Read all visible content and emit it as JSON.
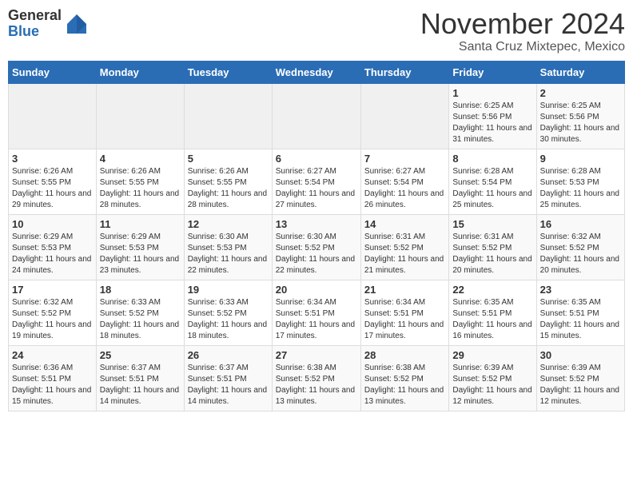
{
  "logo": {
    "general": "General",
    "blue": "Blue"
  },
  "header": {
    "month": "November 2024",
    "location": "Santa Cruz Mixtepec, Mexico"
  },
  "days_of_week": [
    "Sunday",
    "Monday",
    "Tuesday",
    "Wednesday",
    "Thursday",
    "Friday",
    "Saturday"
  ],
  "weeks": [
    [
      {
        "day": "",
        "info": ""
      },
      {
        "day": "",
        "info": ""
      },
      {
        "day": "",
        "info": ""
      },
      {
        "day": "",
        "info": ""
      },
      {
        "day": "",
        "info": ""
      },
      {
        "day": "1",
        "info": "Sunrise: 6:25 AM\nSunset: 5:56 PM\nDaylight: 11 hours and 31 minutes."
      },
      {
        "day": "2",
        "info": "Sunrise: 6:25 AM\nSunset: 5:56 PM\nDaylight: 11 hours and 30 minutes."
      }
    ],
    [
      {
        "day": "3",
        "info": "Sunrise: 6:26 AM\nSunset: 5:55 PM\nDaylight: 11 hours and 29 minutes."
      },
      {
        "day": "4",
        "info": "Sunrise: 6:26 AM\nSunset: 5:55 PM\nDaylight: 11 hours and 28 minutes."
      },
      {
        "day": "5",
        "info": "Sunrise: 6:26 AM\nSunset: 5:55 PM\nDaylight: 11 hours and 28 minutes."
      },
      {
        "day": "6",
        "info": "Sunrise: 6:27 AM\nSunset: 5:54 PM\nDaylight: 11 hours and 27 minutes."
      },
      {
        "day": "7",
        "info": "Sunrise: 6:27 AM\nSunset: 5:54 PM\nDaylight: 11 hours and 26 minutes."
      },
      {
        "day": "8",
        "info": "Sunrise: 6:28 AM\nSunset: 5:54 PM\nDaylight: 11 hours and 25 minutes."
      },
      {
        "day": "9",
        "info": "Sunrise: 6:28 AM\nSunset: 5:53 PM\nDaylight: 11 hours and 25 minutes."
      }
    ],
    [
      {
        "day": "10",
        "info": "Sunrise: 6:29 AM\nSunset: 5:53 PM\nDaylight: 11 hours and 24 minutes."
      },
      {
        "day": "11",
        "info": "Sunrise: 6:29 AM\nSunset: 5:53 PM\nDaylight: 11 hours and 23 minutes."
      },
      {
        "day": "12",
        "info": "Sunrise: 6:30 AM\nSunset: 5:53 PM\nDaylight: 11 hours and 22 minutes."
      },
      {
        "day": "13",
        "info": "Sunrise: 6:30 AM\nSunset: 5:52 PM\nDaylight: 11 hours and 22 minutes."
      },
      {
        "day": "14",
        "info": "Sunrise: 6:31 AM\nSunset: 5:52 PM\nDaylight: 11 hours and 21 minutes."
      },
      {
        "day": "15",
        "info": "Sunrise: 6:31 AM\nSunset: 5:52 PM\nDaylight: 11 hours and 20 minutes."
      },
      {
        "day": "16",
        "info": "Sunrise: 6:32 AM\nSunset: 5:52 PM\nDaylight: 11 hours and 20 minutes."
      }
    ],
    [
      {
        "day": "17",
        "info": "Sunrise: 6:32 AM\nSunset: 5:52 PM\nDaylight: 11 hours and 19 minutes."
      },
      {
        "day": "18",
        "info": "Sunrise: 6:33 AM\nSunset: 5:52 PM\nDaylight: 11 hours and 18 minutes."
      },
      {
        "day": "19",
        "info": "Sunrise: 6:33 AM\nSunset: 5:52 PM\nDaylight: 11 hours and 18 minutes."
      },
      {
        "day": "20",
        "info": "Sunrise: 6:34 AM\nSunset: 5:51 PM\nDaylight: 11 hours and 17 minutes."
      },
      {
        "day": "21",
        "info": "Sunrise: 6:34 AM\nSunset: 5:51 PM\nDaylight: 11 hours and 17 minutes."
      },
      {
        "day": "22",
        "info": "Sunrise: 6:35 AM\nSunset: 5:51 PM\nDaylight: 11 hours and 16 minutes."
      },
      {
        "day": "23",
        "info": "Sunrise: 6:35 AM\nSunset: 5:51 PM\nDaylight: 11 hours and 15 minutes."
      }
    ],
    [
      {
        "day": "24",
        "info": "Sunrise: 6:36 AM\nSunset: 5:51 PM\nDaylight: 11 hours and 15 minutes."
      },
      {
        "day": "25",
        "info": "Sunrise: 6:37 AM\nSunset: 5:51 PM\nDaylight: 11 hours and 14 minutes."
      },
      {
        "day": "26",
        "info": "Sunrise: 6:37 AM\nSunset: 5:51 PM\nDaylight: 11 hours and 14 minutes."
      },
      {
        "day": "27",
        "info": "Sunrise: 6:38 AM\nSunset: 5:52 PM\nDaylight: 11 hours and 13 minutes."
      },
      {
        "day": "28",
        "info": "Sunrise: 6:38 AM\nSunset: 5:52 PM\nDaylight: 11 hours and 13 minutes."
      },
      {
        "day": "29",
        "info": "Sunrise: 6:39 AM\nSunset: 5:52 PM\nDaylight: 11 hours and 12 minutes."
      },
      {
        "day": "30",
        "info": "Sunrise: 6:39 AM\nSunset: 5:52 PM\nDaylight: 11 hours and 12 minutes."
      }
    ]
  ]
}
